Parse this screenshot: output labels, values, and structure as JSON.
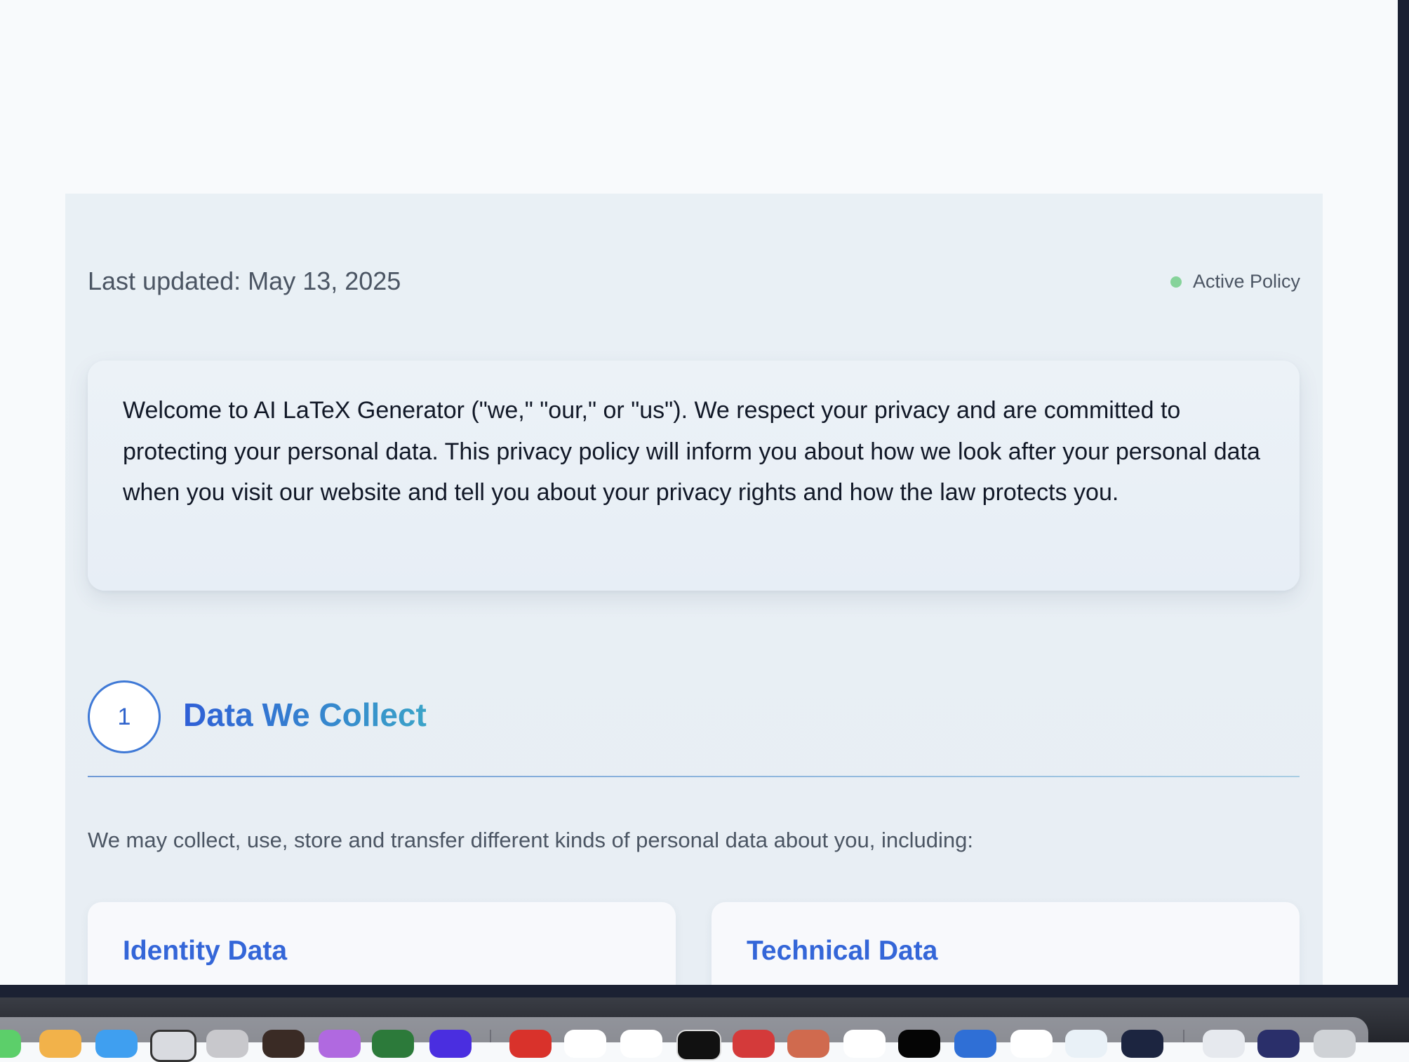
{
  "policy": {
    "last_updated": "Last updated: May 13, 2025",
    "status_label": "Active Policy",
    "status_color": "#86d39a"
  },
  "intro": {
    "text": "Welcome to AI LaTeX Generator (\"we,\" \"our,\" or \"us\"). We respect your privacy and are committed to protecting your personal data. This privacy policy will inform you about how we look after your personal data when you visit our website and tell you about your privacy rights and how the law protects you."
  },
  "section1": {
    "number": "1",
    "title": "Data We Collect",
    "description": "We may collect, use, store and transfer different kinds of personal data about you, including:",
    "cards": [
      {
        "title": "Identity Data"
      },
      {
        "title": "Technical Data"
      }
    ]
  },
  "colors": {
    "accent": "#2f63cc",
    "accent_gradient_end": "#3aa3c8",
    "background": "#e9f0f5"
  }
}
